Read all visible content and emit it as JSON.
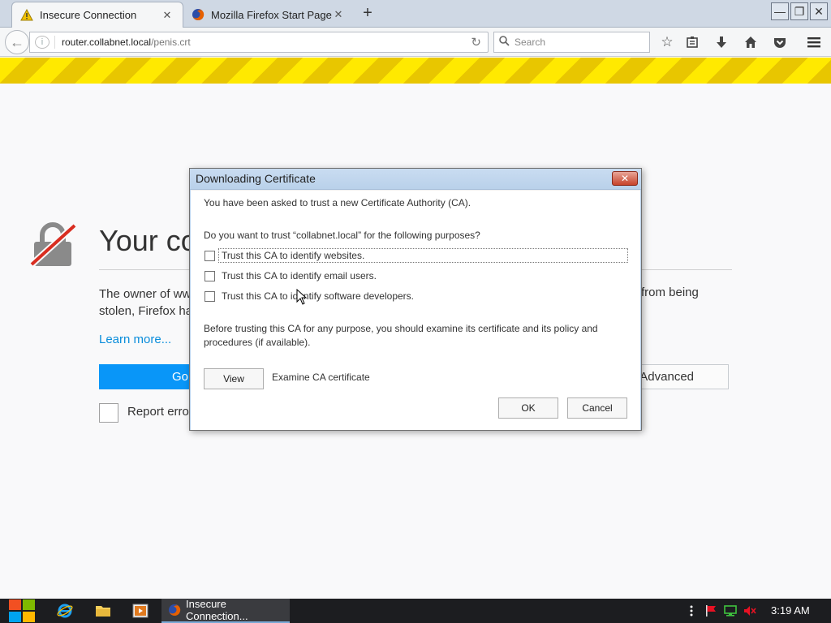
{
  "tabs": [
    {
      "label": "Insecure Connection",
      "icon": "warning-icon",
      "active": true
    },
    {
      "label": "Mozilla Firefox Start Page",
      "icon": "firefox-icon",
      "active": false
    }
  ],
  "navbar": {
    "url_host": "router.collabnet.local",
    "url_path": "/penis.crt",
    "search_placeholder": "Search"
  },
  "error_page": {
    "title_visible": "Your co",
    "text_line1": "The owner of ww",
    "text_line2": "stolen, Firefox ha",
    "text_right": "from being",
    "learn_more": "Learn more...",
    "go_back_label": "Go",
    "advanced_label": "Advanced",
    "report_label": "Report erro"
  },
  "dialog": {
    "title": "Downloading Certificate",
    "intro": "You have been asked to trust a new Certificate Authority (CA).",
    "question": "Do you want to trust “collabnet.local” for the following purposes?",
    "options": [
      {
        "label": "Trust this CA to identify websites.",
        "checked": false
      },
      {
        "label": "Trust this CA to identify email users.",
        "checked": false
      },
      {
        "label": "Trust this CA to identify software developers.",
        "checked": false
      }
    ],
    "note": "Before trusting this CA for any purpose, you should examine its certificate and its policy and procedures (if available).",
    "view_button": "View",
    "view_label": "Examine CA certificate",
    "ok_button": "OK",
    "cancel_button": "Cancel"
  },
  "taskbar": {
    "active_task": "Insecure Connection...",
    "clock": "3:19 AM"
  },
  "colors": {
    "stripe_yellow": "#ffe900",
    "primary_button": "#0996f8",
    "link": "#0a8ddb"
  }
}
